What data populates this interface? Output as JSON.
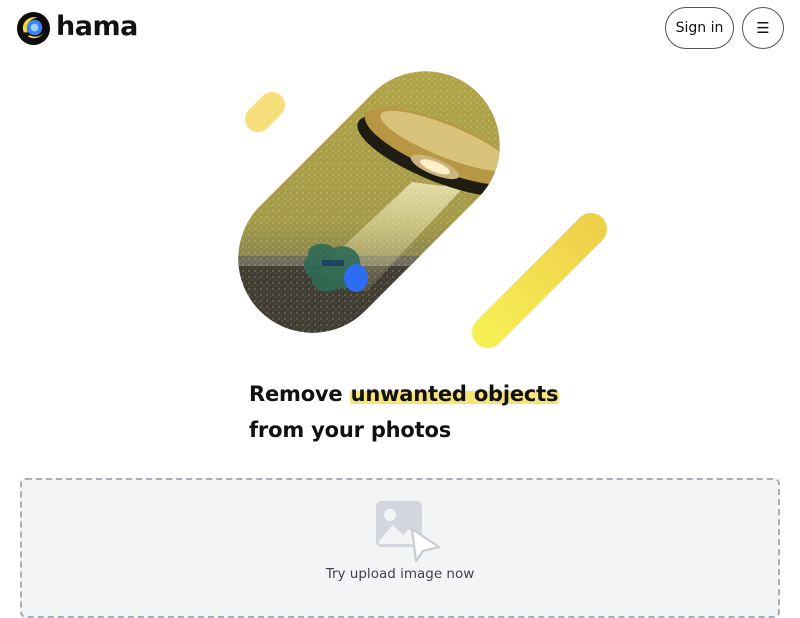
{
  "header": {
    "logo_text": "hama",
    "signin_label": "Sign in",
    "menu_icon": "☰"
  },
  "hero": {
    "headline_part1": "Remove ",
    "headline_highlight": "unwanted objects",
    "headline_part2": "from your photos",
    "image_subject": "ufo-over-field-photo"
  },
  "upload": {
    "label": "Try upload image now",
    "icon": "image-upload-icon"
  },
  "colors": {
    "accent_yellow": "#f3e04c",
    "logo_blue": "#1f4fd6",
    "logo_yellow": "#f6d63b",
    "upload_bg": "#f3f4f6",
    "brush_blue": "#2c6df2"
  }
}
